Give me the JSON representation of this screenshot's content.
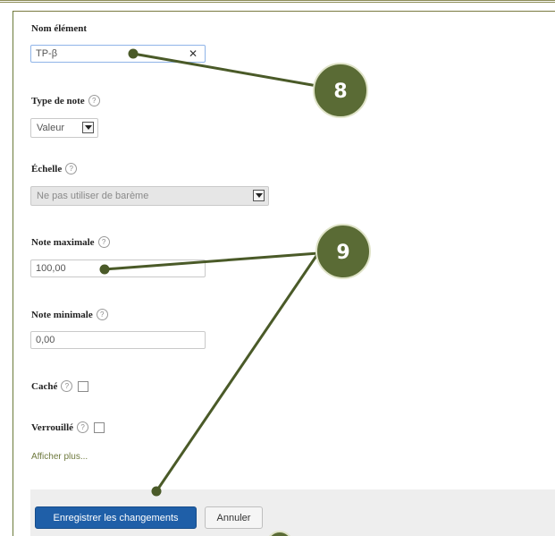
{
  "form": {
    "name_field": {
      "label": "Nom élément",
      "value": "TP-β"
    },
    "grade_type": {
      "label": "Type de note",
      "value": "Valeur"
    },
    "scale": {
      "label": "Échelle",
      "value": "Ne pas utiliser de barème"
    },
    "max_grade": {
      "label": "Note maximale",
      "value": "100,00"
    },
    "min_grade": {
      "label": "Note minimale",
      "value": "0,00"
    },
    "hidden": {
      "label": "Caché"
    },
    "locked": {
      "label": "Verrouillé"
    },
    "show_more": "Afficher plus..."
  },
  "footer": {
    "save_label": "Enregistrer les changements",
    "cancel_label": "Annuler"
  },
  "annotations": {
    "callout_8": "8",
    "callout_9": "9"
  },
  "colors": {
    "callout_fill": "#5a6b35",
    "callout_line": "#4a5a28",
    "primary_button": "#1f5fa8"
  }
}
